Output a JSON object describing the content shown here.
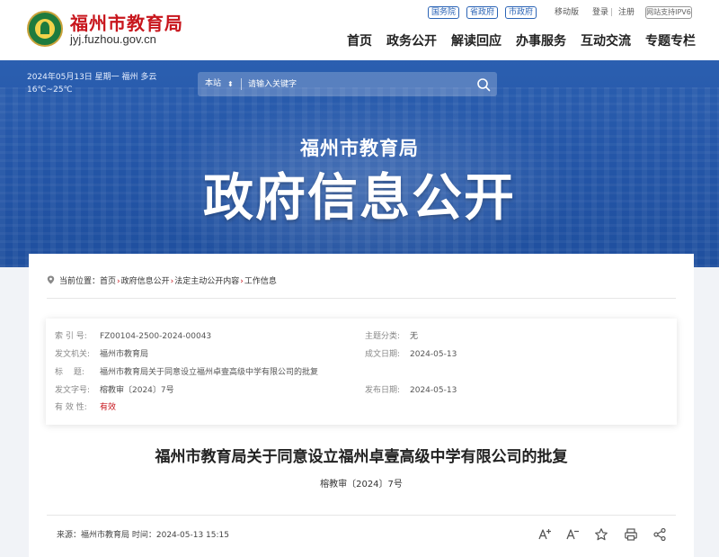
{
  "header": {
    "site_name": "福州市教育局",
    "domain": "jyj.fuzhou.gov.cn",
    "util_links": [
      "国务院",
      "省政府",
      "市政府"
    ],
    "mobile": "移动版",
    "login": "登录",
    "sep": "|",
    "register": "注册",
    "ipv6": "网站支持IPV6",
    "nav": [
      "首页",
      "政务公开",
      "解读回应",
      "办事服务",
      "互动交流",
      "专题专栏"
    ]
  },
  "hero": {
    "weather": "2024年05月13日  星期一 福州 多云 16℃~25℃",
    "search_scope": "本站",
    "search_caret": "⬍",
    "search_placeholder": "请输入关键字",
    "subtitle": "福州市教育局",
    "title": "政府信息公开"
  },
  "breadcrumb": {
    "prefix": "当前位置：",
    "items": [
      "首页",
      "政府信息公开",
      "法定主动公开内容",
      "工作信息"
    ],
    "separator": "›"
  },
  "meta": {
    "index_label": "索 引 号:",
    "index_value": "FZ00104-2500-2024-00043",
    "topic_label": "主题分类:",
    "topic_value": "无",
    "issuer_label": "发文机关:",
    "issuer_value": "福州市教育局",
    "created_label": "成文日期:",
    "created_value": "2024-05-13",
    "title_label": "标　 题:",
    "title_value": "福州市教育局关于同意设立福州卓壹高级中学有限公司的批复",
    "docno_label": "发文字号:",
    "docno_value": "榕教审〔2024〕7号",
    "published_label": "发布日期:",
    "published_value": "2024-05-13",
    "valid_label": "有 效 性:",
    "valid_value": "有效"
  },
  "article": {
    "title": "福州市教育局关于同意设立福州卓壹高级中学有限公司的批复",
    "doc_number": "榕教审〔2024〕7号",
    "source": "来源：福州市教育局    时间：2024-05-13 15:15",
    "tools": [
      "font-increase-icon",
      "font-decrease-icon",
      "favorite-star-icon",
      "print-icon",
      "share-icon"
    ]
  },
  "colors": {
    "brand_red": "#c8161d",
    "link_blue": "#2b64b6",
    "hero_blue": "#2456a8"
  }
}
